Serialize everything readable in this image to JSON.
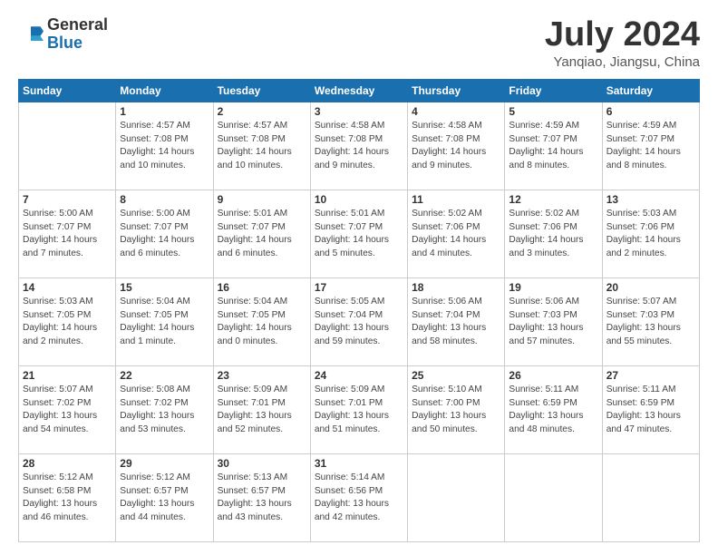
{
  "header": {
    "logo_general": "General",
    "logo_blue": "Blue",
    "month_title": "July 2024",
    "location": "Yanqiao, Jiangsu, China"
  },
  "days_of_week": [
    "Sunday",
    "Monday",
    "Tuesday",
    "Wednesday",
    "Thursday",
    "Friday",
    "Saturday"
  ],
  "weeks": [
    [
      {
        "date": "",
        "info": ""
      },
      {
        "date": "1",
        "info": "Sunrise: 4:57 AM\nSunset: 7:08 PM\nDaylight: 14 hours\nand 10 minutes."
      },
      {
        "date": "2",
        "info": "Sunrise: 4:57 AM\nSunset: 7:08 PM\nDaylight: 14 hours\nand 10 minutes."
      },
      {
        "date": "3",
        "info": "Sunrise: 4:58 AM\nSunset: 7:08 PM\nDaylight: 14 hours\nand 9 minutes."
      },
      {
        "date": "4",
        "info": "Sunrise: 4:58 AM\nSunset: 7:08 PM\nDaylight: 14 hours\nand 9 minutes."
      },
      {
        "date": "5",
        "info": "Sunrise: 4:59 AM\nSunset: 7:07 PM\nDaylight: 14 hours\nand 8 minutes."
      },
      {
        "date": "6",
        "info": "Sunrise: 4:59 AM\nSunset: 7:07 PM\nDaylight: 14 hours\nand 8 minutes."
      }
    ],
    [
      {
        "date": "7",
        "info": "Sunrise: 5:00 AM\nSunset: 7:07 PM\nDaylight: 14 hours\nand 7 minutes."
      },
      {
        "date": "8",
        "info": "Sunrise: 5:00 AM\nSunset: 7:07 PM\nDaylight: 14 hours\nand 6 minutes."
      },
      {
        "date": "9",
        "info": "Sunrise: 5:01 AM\nSunset: 7:07 PM\nDaylight: 14 hours\nand 6 minutes."
      },
      {
        "date": "10",
        "info": "Sunrise: 5:01 AM\nSunset: 7:07 PM\nDaylight: 14 hours\nand 5 minutes."
      },
      {
        "date": "11",
        "info": "Sunrise: 5:02 AM\nSunset: 7:06 PM\nDaylight: 14 hours\nand 4 minutes."
      },
      {
        "date": "12",
        "info": "Sunrise: 5:02 AM\nSunset: 7:06 PM\nDaylight: 14 hours\nand 3 minutes."
      },
      {
        "date": "13",
        "info": "Sunrise: 5:03 AM\nSunset: 7:06 PM\nDaylight: 14 hours\nand 2 minutes."
      }
    ],
    [
      {
        "date": "14",
        "info": "Sunrise: 5:03 AM\nSunset: 7:05 PM\nDaylight: 14 hours\nand 2 minutes."
      },
      {
        "date": "15",
        "info": "Sunrise: 5:04 AM\nSunset: 7:05 PM\nDaylight: 14 hours\nand 1 minute."
      },
      {
        "date": "16",
        "info": "Sunrise: 5:04 AM\nSunset: 7:05 PM\nDaylight: 14 hours\nand 0 minutes."
      },
      {
        "date": "17",
        "info": "Sunrise: 5:05 AM\nSunset: 7:04 PM\nDaylight: 13 hours\nand 59 minutes."
      },
      {
        "date": "18",
        "info": "Sunrise: 5:06 AM\nSunset: 7:04 PM\nDaylight: 13 hours\nand 58 minutes."
      },
      {
        "date": "19",
        "info": "Sunrise: 5:06 AM\nSunset: 7:03 PM\nDaylight: 13 hours\nand 57 minutes."
      },
      {
        "date": "20",
        "info": "Sunrise: 5:07 AM\nSunset: 7:03 PM\nDaylight: 13 hours\nand 55 minutes."
      }
    ],
    [
      {
        "date": "21",
        "info": "Sunrise: 5:07 AM\nSunset: 7:02 PM\nDaylight: 13 hours\nand 54 minutes."
      },
      {
        "date": "22",
        "info": "Sunrise: 5:08 AM\nSunset: 7:02 PM\nDaylight: 13 hours\nand 53 minutes."
      },
      {
        "date": "23",
        "info": "Sunrise: 5:09 AM\nSunset: 7:01 PM\nDaylight: 13 hours\nand 52 minutes."
      },
      {
        "date": "24",
        "info": "Sunrise: 5:09 AM\nSunset: 7:01 PM\nDaylight: 13 hours\nand 51 minutes."
      },
      {
        "date": "25",
        "info": "Sunrise: 5:10 AM\nSunset: 7:00 PM\nDaylight: 13 hours\nand 50 minutes."
      },
      {
        "date": "26",
        "info": "Sunrise: 5:11 AM\nSunset: 6:59 PM\nDaylight: 13 hours\nand 48 minutes."
      },
      {
        "date": "27",
        "info": "Sunrise: 5:11 AM\nSunset: 6:59 PM\nDaylight: 13 hours\nand 47 minutes."
      }
    ],
    [
      {
        "date": "28",
        "info": "Sunrise: 5:12 AM\nSunset: 6:58 PM\nDaylight: 13 hours\nand 46 minutes."
      },
      {
        "date": "29",
        "info": "Sunrise: 5:12 AM\nSunset: 6:57 PM\nDaylight: 13 hours\nand 44 minutes."
      },
      {
        "date": "30",
        "info": "Sunrise: 5:13 AM\nSunset: 6:57 PM\nDaylight: 13 hours\nand 43 minutes."
      },
      {
        "date": "31",
        "info": "Sunrise: 5:14 AM\nSunset: 6:56 PM\nDaylight: 13 hours\nand 42 minutes."
      },
      {
        "date": "",
        "info": ""
      },
      {
        "date": "",
        "info": ""
      },
      {
        "date": "",
        "info": ""
      }
    ]
  ]
}
